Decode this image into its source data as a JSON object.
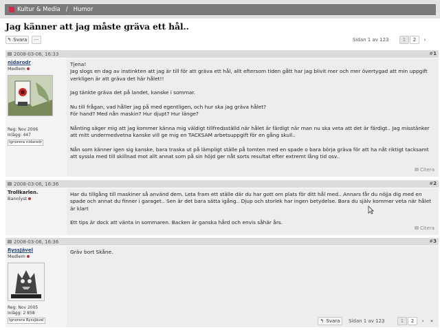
{
  "breadcrumb": {
    "section": "Kultur & Media",
    "subsection": "Humor"
  },
  "thread_title": "Jag känner att jag måste gräva ett hål..",
  "toolbar": {
    "reply_label": "Svara",
    "more_label": "···"
  },
  "pagination_top": {
    "label": "Sidan 1 av 123",
    "pages": [
      "1",
      "2"
    ],
    "next_label": "›"
  },
  "pagination_bottom": {
    "reply_label": "Svara",
    "label": "Sidan 1 av 123",
    "pages": [
      "1",
      "2"
    ],
    "next_label": "›",
    "last_label": "»"
  },
  "posts": [
    {
      "timestamp": "2008-03-06, 16:33",
      "number": "1",
      "author": "nidarodr",
      "role": "Medlem",
      "reg": "Reg: Nov 2006",
      "posts_count": "Inlägg: 447",
      "ignore_label": "Ignorera nidarodr",
      "paragraphs": [
        "Tjena!\nJag slogs en dag av instinkten att jag är till för att gräva ett hål, allt eftersom tiden gått har jag blivit mer och mer övertygad att min uppgift verkligen är att gräva det här hålet!!",
        "Jag tänkte gräva det på landet, kanske i sommar.",
        "Nu till frågan, vad håller jag på med egentligen, och hur ska jag gräva hålet?\nFör hand? Med nån maskin? Hur djupt? Hur länge?",
        "Nånting säger mig att jag kommer känna mig väldigt tillfredsställd när hålet är färdigt när man nu ska veta att det är färdigt.. Jag misstänker att mitt undermedvetna kanske vill ge mig en TACKSAM arbetsuppgift för en gång skull..",
        "Nån som känner igen sig kanske, bara traska ut på lämpligt ställe på tomten med en spade o bara börja gräva för att ha nåt riktigt tacksamt att syssla med till skillnad mot allt annat som på sin höjd ger nåt sorts resultat efter extremt lång tid osv.."
      ],
      "quote_label": "Citera"
    },
    {
      "timestamp": "2008-03-06, 16:36",
      "number": "2",
      "author": "Trollkarlen.",
      "role": "Bannlyst",
      "paragraphs": [
        "Har du tillgång till maskiner så använd dem. Leta fram ett ställe där du har gott om plats för ditt hål med.. Annars får du nöjja dig med en spade och annat du finner i garaget.. Sen är det bara sätta igång.. Djup och storlek har ingen betydelse. Bara du själv kommer veta när hålet är klart",
        "Ett tips är dock att vänta in sommaren. Backen är ganska hård och envis såhär års."
      ],
      "quote_label": "Citera"
    },
    {
      "timestamp": "2008-03-06, 16:36",
      "number": "3",
      "author": "RyssJävel",
      "role": "Medlem",
      "reg": "Reg: Nov 2005",
      "posts_count": "Inlägg: 2 858",
      "ignore_label": "Ignorera RyssJävel",
      "paragraphs": [
        "Gräv bort Skåne."
      ]
    }
  ]
}
